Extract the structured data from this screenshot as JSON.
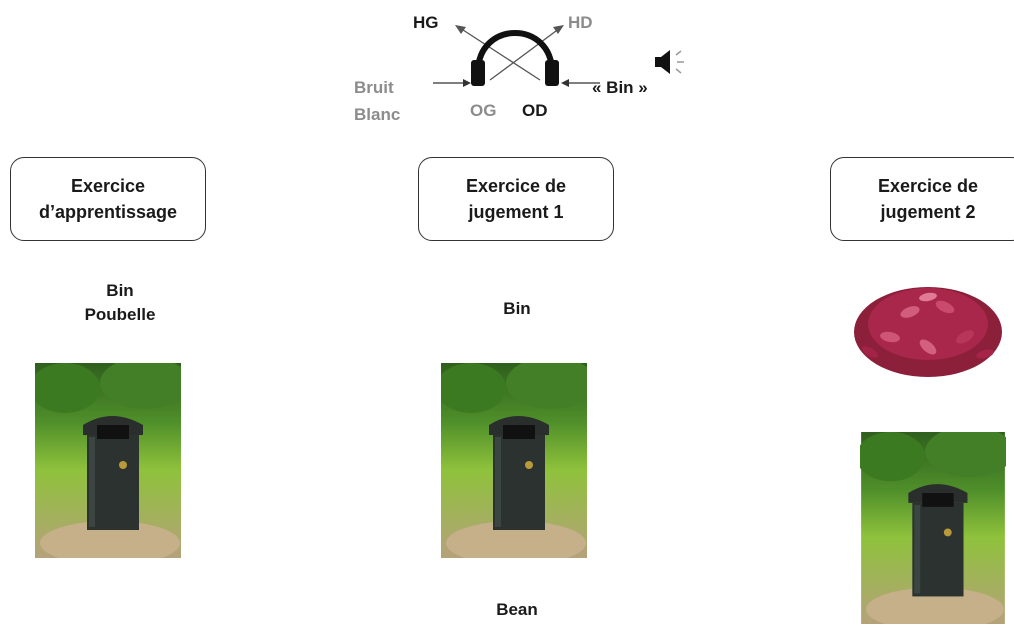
{
  "diagram": {
    "headphone_labels": {
      "hg": "HG",
      "hd": "HD",
      "og": "OG",
      "od": "OD",
      "left_input_line1": "Bruit",
      "left_input_line2": "Blanc",
      "right_input": "« Bin »"
    },
    "panels": [
      {
        "title_line1": "Exercice",
        "title_line2": "d’apprentissage",
        "word_line1": "Bin",
        "word_line2": "Poubelle",
        "images": [
          "trash-bin-photo"
        ]
      },
      {
        "title_line1": "Exercice de",
        "title_line2": "jugement 1",
        "word_top": "Bin",
        "word_bottom": "Bean",
        "images": [
          "trash-bin-photo"
        ]
      },
      {
        "title_line1": "Exercice de",
        "title_line2": "jugement 2",
        "images": [
          "kidney-beans-photo",
          "trash-bin-photo"
        ]
      }
    ],
    "colors": {
      "dark_text": "#1a1a1a",
      "grey_text": "#8c8c8c",
      "box_border": "#333333"
    }
  }
}
